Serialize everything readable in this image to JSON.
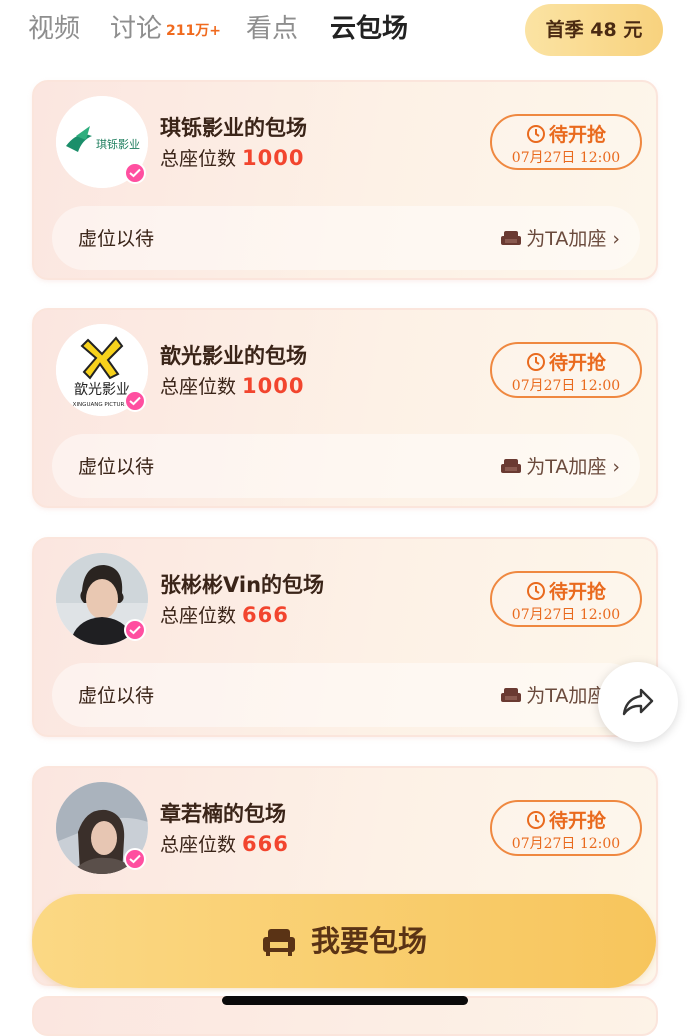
{
  "tabs": {
    "video": "视频",
    "discussion": "讨论",
    "discussion_count": "211万+",
    "highlights": "看点",
    "cloud_screening": "云包场"
  },
  "season_button": "首季 48 元",
  "cards": [
    {
      "title": "琪铄影业的包场",
      "seat_label": "总座位数",
      "seat_count": "1000",
      "status": "待开抢",
      "time": "07月27日 12:00",
      "seat_bar_label": "虚位以待",
      "add_seat_label": "为TA加座",
      "avatar_text": "琪铄影业"
    },
    {
      "title": "歆光影业的包场",
      "seat_label": "总座位数",
      "seat_count": "1000",
      "status": "待开抢",
      "time": "07月27日 12:00",
      "seat_bar_label": "虚位以待",
      "add_seat_label": "为TA加座",
      "avatar_text": "歆光影业",
      "avatar_subtext": "XINGUANG PICTURES"
    },
    {
      "title": "张彬彬Vin的包场",
      "seat_label": "总座位数",
      "seat_count": "666",
      "status": "待开抢",
      "time": "07月27日 12:00",
      "seat_bar_label": "虚位以待",
      "add_seat_label": "为TA加座"
    },
    {
      "title": "章若楠的包场",
      "seat_label": "总座位数",
      "seat_count": "666",
      "status": "待开抢",
      "time": "07月27日 12:00"
    }
  ],
  "bottom_button": "我要包场",
  "icons": {
    "status": "clock-icon",
    "add_seat": "sofa-icon",
    "bottom_button": "sofa-icon",
    "share": "share-arrow-icon",
    "verified": "verified-badge-icon"
  },
  "colors": {
    "accent_orange": "#e96a1e",
    "seat_count_red": "#f2452e",
    "verified_pink": "#ff4fa0",
    "button_gold": "#f7c55c"
  }
}
